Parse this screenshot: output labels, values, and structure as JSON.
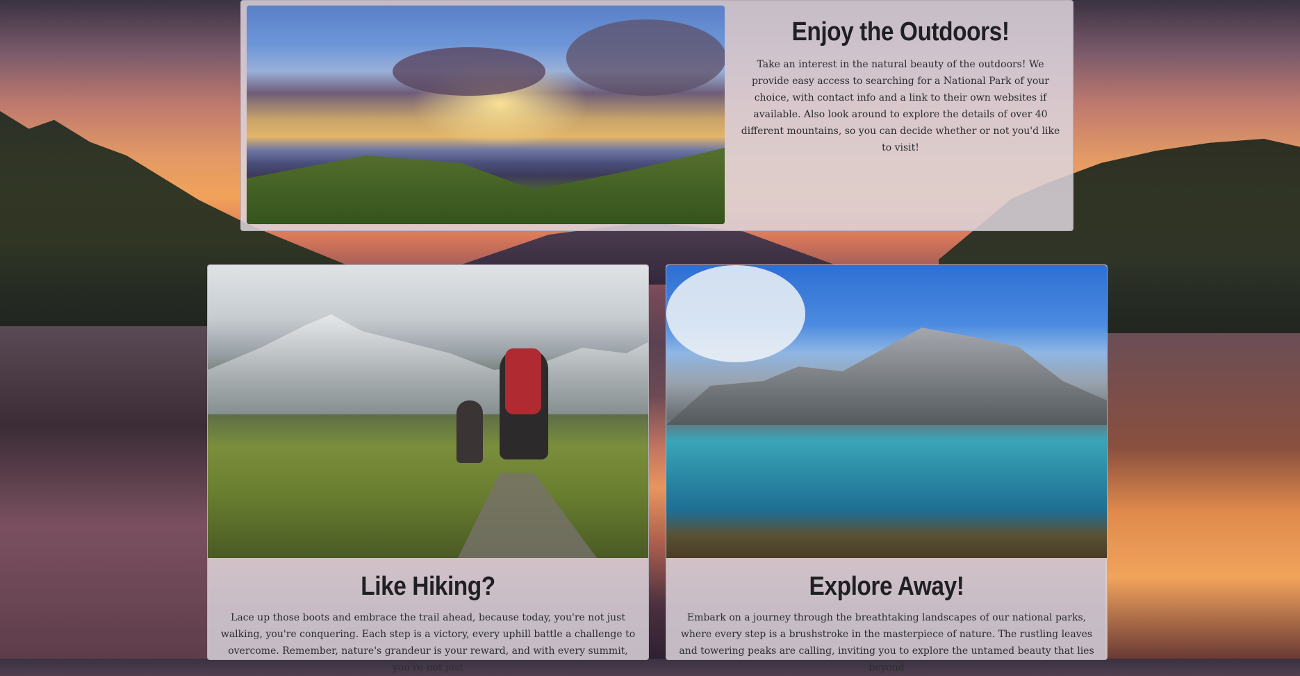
{
  "background": {
    "scene": "sunset-lake-forest",
    "colors": {
      "sky": "#e39a64",
      "water": "#5a4252",
      "trees": "#1f2a22"
    }
  },
  "top_card": {
    "image_alt": "sunset-over-mountains",
    "title": "Enjoy the Outdoors!",
    "text": "Take an interest in the natural beauty of the outdoors! We provide easy access to searching for a National Park of your choice, with contact info and a link to their own websites if available. Also look around to explore the details of over 40 different mountains, so you can decide whether or not you'd like to visit!"
  },
  "hiking_card": {
    "image_alt": "hikers-on-mountain-trail",
    "title": "Like Hiking?",
    "text": "Lace up those boots and embrace the trail ahead, because today, you're not just walking, you're conquering. Each step is a victory, every uphill battle a challenge to overcome. Remember, nature's grandeur is your reward, and with every summit, you're not just"
  },
  "explore_card": {
    "image_alt": "alpine-lake-with-mountains",
    "title": "Explore Away!",
    "text": "Embark on a journey through the breathtaking landscapes of our national parks, where every step is a brushstroke in the masterpiece of nature. The rustling leaves and towering peaks are calling, inviting you to explore the untamed beauty that lies beyond"
  }
}
